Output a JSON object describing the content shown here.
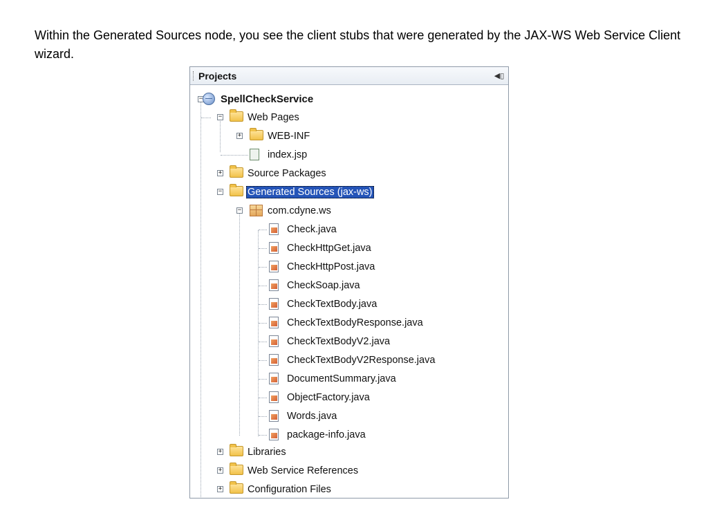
{
  "caption": "Within the Generated Sources node, you see the client stubs that were generated by the JAX-WS Web Service Client wizard.",
  "panel": {
    "title": "Projects",
    "minimize_icon": "◀▯"
  },
  "tree": {
    "project": "SpellCheckService",
    "web_pages": "Web Pages",
    "web_inf": "WEB-INF",
    "index_jsp": "index.jsp",
    "source_packages": "Source Packages",
    "generated_sources": "Generated Sources (jax-ws)",
    "package": "com.cdyne.ws",
    "files": [
      "Check.java",
      "CheckHttpGet.java",
      "CheckHttpPost.java",
      "CheckSoap.java",
      "CheckTextBody.java",
      "CheckTextBodyResponse.java",
      "CheckTextBodyV2.java",
      "CheckTextBodyV2Response.java",
      "DocumentSummary.java",
      "ObjectFactory.java",
      "Words.java",
      "package-info.java"
    ],
    "libraries": "Libraries",
    "web_service_references": "Web Service References",
    "configuration_files": "Configuration Files"
  },
  "toggle_symbols": {
    "expanded": "−",
    "collapsed": "+"
  }
}
